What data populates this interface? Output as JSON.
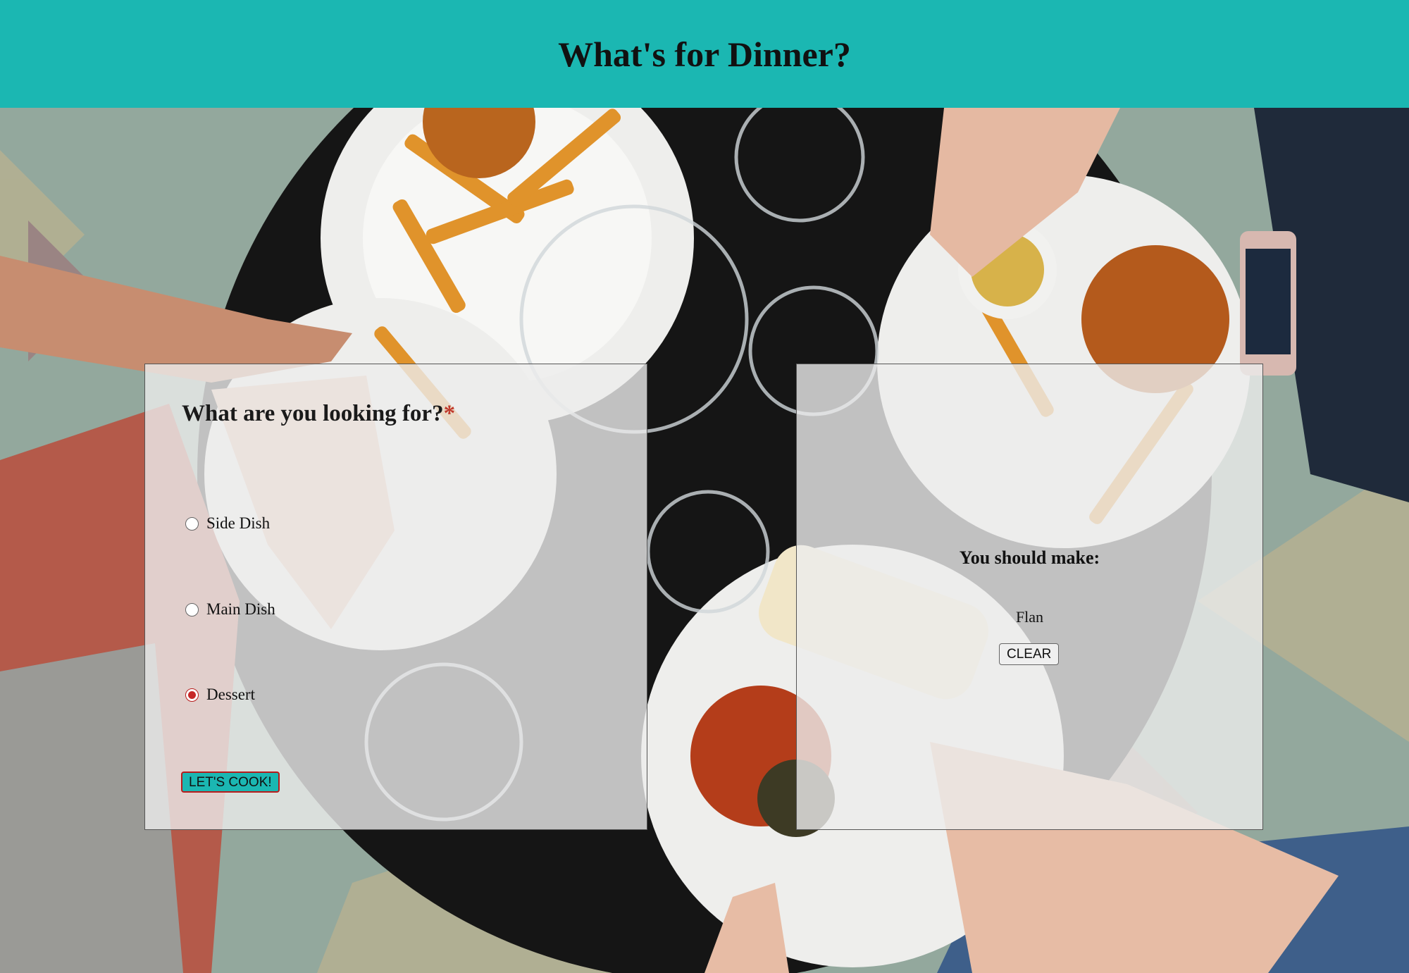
{
  "header": {
    "title": "What's for Dinner?"
  },
  "form": {
    "question": "What are you looking for?",
    "required_mark": "*",
    "options": [
      {
        "label": "Side Dish",
        "checked": false
      },
      {
        "label": "Main Dish",
        "checked": false
      },
      {
        "label": "Dessert",
        "checked": true
      }
    ],
    "submit_label": "LET'S COOK!"
  },
  "result": {
    "title": "You should make:",
    "value": "Flan",
    "clear_label": "CLEAR"
  },
  "colors": {
    "header_bg": "#1bb7b2",
    "accent": "#1bb7b2",
    "required": "#c0392b",
    "radio_checked": "#c62828"
  },
  "background": {
    "description_icon": "food-table-photo"
  }
}
